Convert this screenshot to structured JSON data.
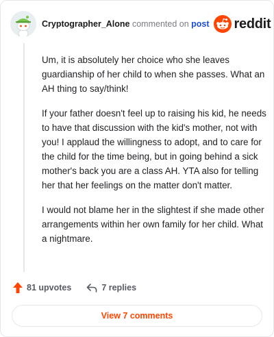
{
  "header": {
    "username": "Cryptographer_Alone",
    "commented_text": "commented on",
    "post_link": "post",
    "brand": "reddit"
  },
  "comment": {
    "paragraphs": [
      "Um, it is absolutely her choice who she leaves guardianship of her child to when she passes. What an AH thing to say/think!",
      "If your father doesn't feel up to raising his kid, he needs to have that discussion with the kid's mother, not with you! I applaud the willingness to adopt, and to care for the child for the time being, but in going behind a sick mother's back you are a class AH. YTA also for telling her that her feelings on the matter don't matter.",
      "I would not blame her in the slightest if she made other arrangements within her own family for her child. What a nightmare."
    ]
  },
  "actions": {
    "upvotes": "81 upvotes",
    "replies": "7 replies",
    "view_comments": "View 7 comments"
  },
  "colors": {
    "accent": "#ff4500",
    "link": "#1d4ed8"
  },
  "icons": {
    "avatar": "snoo-avatar-icon",
    "brand": "reddit-logo-icon",
    "upvote": "upvote-arrow-icon",
    "reply": "reply-arrow-icon"
  }
}
